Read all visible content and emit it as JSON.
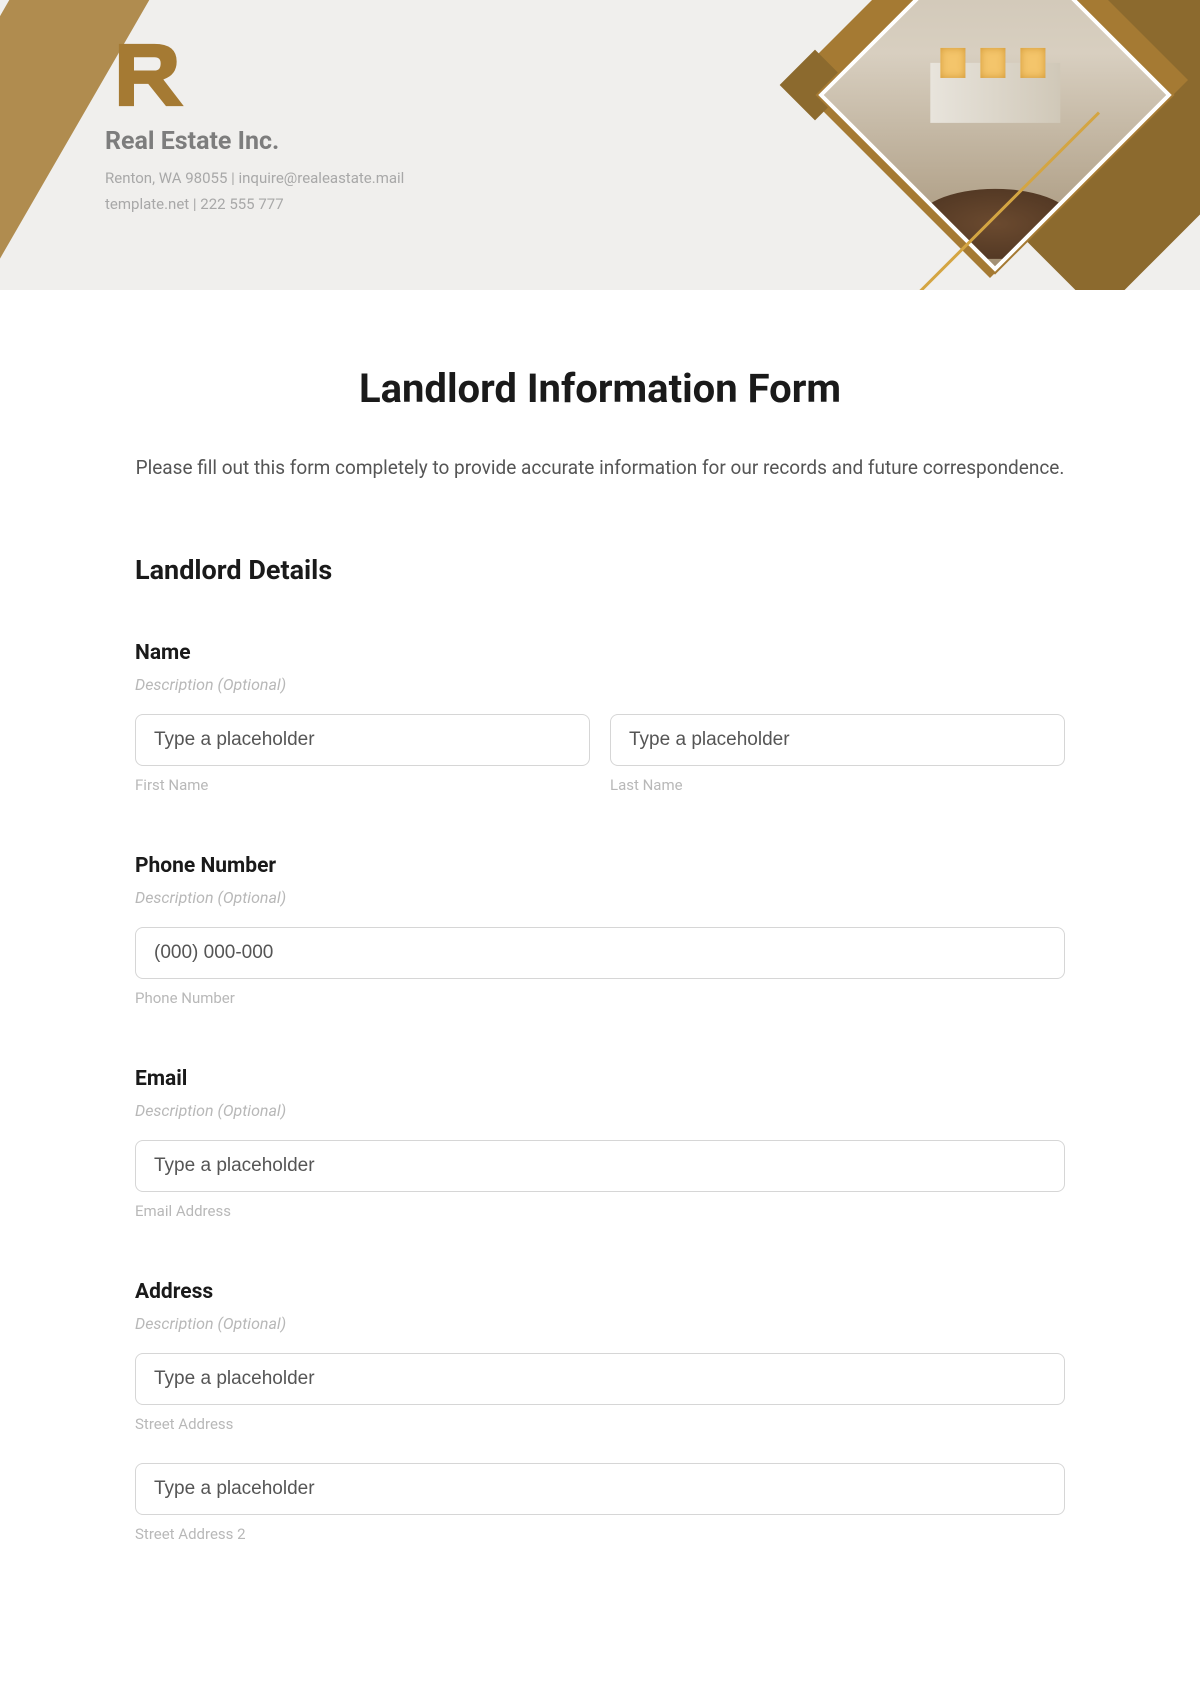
{
  "header": {
    "company_name": "Real Estate Inc.",
    "address_line1": "Renton, WA 98055 | inquire@realeastate.mail",
    "address_line2": "template.net | 222 555 777"
  },
  "form": {
    "title": "Landlord Information Form",
    "description": "Please fill out this form completely to provide accurate information for our records and future correspondence.",
    "section_heading": "Landlord Details",
    "fields": {
      "name": {
        "label": "Name",
        "desc": "Description (Optional)",
        "first_name_placeholder": "Type a placeholder",
        "first_name_sublabel": "First Name",
        "last_name_placeholder": "Type a placeholder",
        "last_name_sublabel": "Last Name"
      },
      "phone": {
        "label": "Phone Number",
        "desc": "Description (Optional)",
        "placeholder": "(000) 000-000",
        "sublabel": "Phone Number"
      },
      "email": {
        "label": "Email",
        "desc": "Description (Optional)",
        "placeholder": "Type a placeholder",
        "sublabel": "Email Address"
      },
      "address": {
        "label": "Address",
        "desc": "Description (Optional)",
        "street1_placeholder": "Type a placeholder",
        "street1_sublabel": "Street Address",
        "street2_placeholder": "Type a placeholder",
        "street2_sublabel": "Street Address 2"
      }
    }
  }
}
